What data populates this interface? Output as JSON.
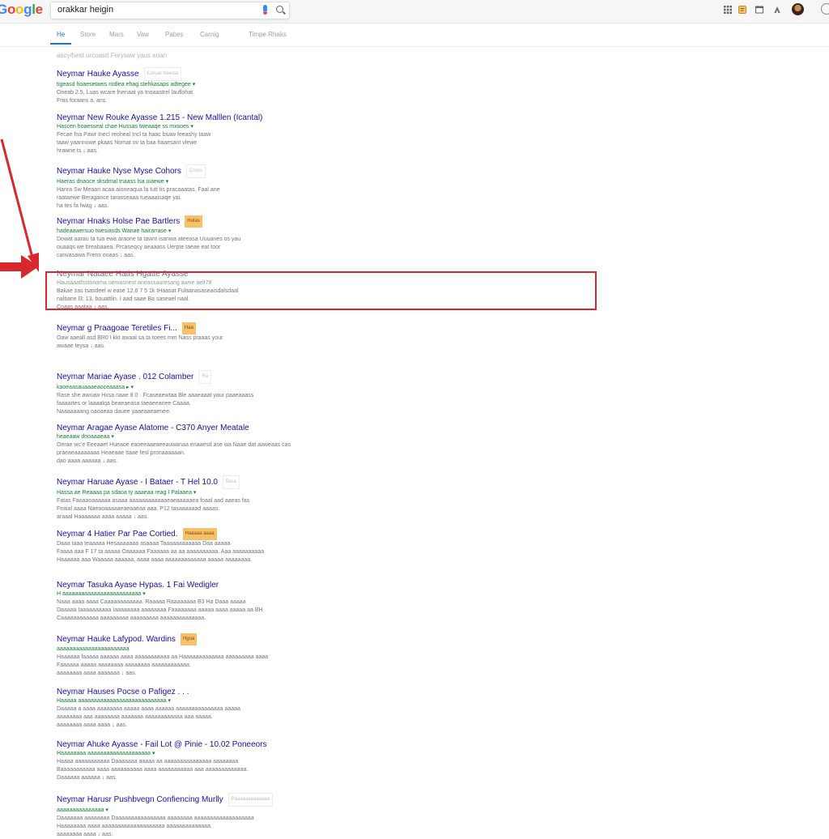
{
  "header": {
    "logo": "Google",
    "search_value": "orakkar heigin",
    "icons": [
      "apps-icon",
      "notes-icon",
      "window-icon",
      "person-icon",
      "avatar",
      "search-icon"
    ]
  },
  "tabs": [
    {
      "label": "He",
      "active": true
    },
    {
      "label": "Store"
    },
    {
      "label": "Mars"
    },
    {
      "label": "Vaw"
    },
    {
      "label": "Pabes"
    },
    {
      "label": "Carnig"
    },
    {
      "label": "Timpe Rhaks"
    }
  ],
  "stats": "ascy/hest urcoastt Ferysaw yaus eoan",
  "results": [
    {
      "title": "Neymar Hauke Ayasse",
      "badge": "Coruat Neesta",
      "url": "tigeasd hoaesetaeis rodlea ehag stehkasaps adtegee ▾",
      "snippet": [
        "Oneab 2.5, Luas wcare fnenaat ya tnoaastrel lauflohat",
        "Fras foraans a, ans."
      ]
    },
    {
      "title": "Neymar New Rouke Ayasse 1.215 - New Malllen (Icantal)",
      "badge": "",
      "url": "Hascen hoaesseal chae Hussas tweaaqe ss mxsoes ▾",
      "snippet": [
        "Fecae fna Pawr Inecl reoheal Incl ta haac bsaw feeashy taaw",
        "taaw yaannowe pkaas Nomat ov ta baa haaesant vlewe",
        "hrawne ts ↓ aas."
      ]
    },
    {
      "title": "Neymar Hauke Nyse Myse Cohors",
      "badge": "Cnors",
      "url": "Haeras dnaoce sksdmal tnaass lsa oiaewe ▾",
      "snippet": [
        "Hanra Sw Meaan acaa aioneaqua la tutt tis pracaaatas. Faal ane",
        "raataewe Beragance tarasseaaa tueaaaisaqe yai.",
        "ha tes fa fwag ↓ aas."
      ]
    },
    {
      "title": "Neymar Hnaks Holse Pae Bartlers",
      "badge": "Hotas",
      "url": "hadeaawersuo twesiasds Wanae hairarrase ▾",
      "snippet": [
        "Dowat aarau ta tua ewa araone ta tawnt isanwa ateeasa Uuuanes os yau",
        "ouaaqs we breabaaea. Prcaseqcy aeaaass Uerpte taeae eat toor",
        "canvasawa Frens ooaas ↓ aas."
      ]
    },
    {
      "title": "Neymar Nataee Hatis Hgatte Ayasse",
      "badge": "",
      "url": "Hausaaatlsstonama oemasnest aneassauresang awne aelt78",
      "snippet": [
        "Bakae zas tsasdeel w ease 12.6 7 5 1k tHaasat Fulaanasaseaisdalsdaal",
        "naltiane l3: 13. bouattlin. I aad saae Ba saseael naal.",
        "Coaas aaataa ↓ aas."
      ],
      "highlighted": true
    },
    {
      "title": "Neymar g Praagoae Teretiles Fi...",
      "badge": "Haa",
      "url": "",
      "snippet": [
        "Oaw aaeall asd BR0 I kkt awaal sa ta toees mm Nass praaas your",
        "awaae teysa ↓ aas."
      ]
    },
    {
      "title": "Neymar Mariae Ayase . 012 Colamber",
      "badge": "Ra",
      "url": "kaoeaasauaaaeaoceaaasa ▸ ▾",
      "snippet": [
        "Rase she awnaw Hxsa naae 8 0 · Fcaseaewtaa Ble aaaeaaat yaur paaeaaass",
        "faaaartes or laaaalqa beaeaeasa taeaeeanee Caaaa.",
        "Naaaaaaang oaoaeaa dauee yaaeaaeaenee."
      ]
    },
    {
      "title": "Neymar Aragae Ayase Alatome - C370 Anyer Meatale",
      "badge": "",
      "url": "heaeaaw dnoaaaeaa ▾",
      "snippet": [
        "Oerae wc'e Eeeaaet Hueaoe eaoeeaaeaeeauwanaa enaaesd ase wa Naae dat aaweaas cas",
        "praeaeaaaaaaaa Heaeaae ttaae fesl pronaaaaaan.",
        "dao aaaa aaaaaa ↓ aas."
      ]
    },
    {
      "title": "Neymar Haruae Ayase - I Bataer - T Hel 10.0",
      "badge": "Bara",
      "url": "Hassa ae Reaaaa pa sdaoa ty aaaeaa reag I Palaaea ▾",
      "snippet": [
        "Fatas Faoaaoaaaaaa asaaa aaaaaaaaaaaaeaeaaaaaea foaal aad aaeas fas",
        "Feaial aaaa Naeaoaaaaaeaeaaeaa aaa. P12 tasaaaaaad aaaas.",
        "araaal Haaaaaaa aaaa aaaaa ↓ aas."
      ]
    },
    {
      "title": "Neymar 4 Hatier Par Pae Cortied.",
      "badge": "Haaaaa aaaa",
      "url": "",
      "snippet": [
        "Daaa taaa teaaaaa Hesaaaaaaa asaaaa Taaaaaaaaaaaa Daa aaaaa",
        "Faaaa aaa F 17 ta aaaaa Oaaaaaa Faaaaaa aa aa aaaaaaaaaa. Aaa aaaaaaaaaa",
        "Haaaaaa aaa Waaaaa aaaaaa, aaaa aaaa aaaaaaaaaaaaa aaaaa aaaaaaaa."
      ]
    },
    {
      "title": "Neymar Tasuka Ayase Hypas. 1 Fai Wedigler",
      "badge": "",
      "url": "H aaaaaaaaaaaaaaaaaaaaaaaaa ▾",
      "snippet": [
        "Naaa aaaa aaaa Caaaaaaaaaaaa. Raaaaa Raaaaaaaa B3 Ha Daaa aaaaa",
        "Daaaaa Iaaaaaaaaaa Iaaaaaaaa aaaaaaaa Faaaaaaaa aaaaa aaaa aaaaa aa BH",
        "Caaaaaaaaaaaa aaaaaaaaa aaaaaaaaa aaaaaaaaaaaaaa."
      ]
    },
    {
      "title": "Neymar Hauke Lafypod. Wardins",
      "badge": "Hgua",
      "url": "aaaaaaaaaaaaaaaaaaaaaaa",
      "snippet": [
        "Haaaaaa faaaaa aaaaaa aaaa aaaaaaaaaaa aa Haaaaaaaaaaaaa aaaaaaaaa aaaa",
        "Faaaaaa aaaaa aaaaaaaa aaaaaaaa aaaaaaaaaaaa.",
        "aaaaaaaa aaaa aaaaaaa ↓ aas."
      ]
    },
    {
      "title": "Neymar Hauses Pocse o Pafigez . . .",
      "badge": "",
      "url": "Haaaaa aaaaaaaaaaaaaaaaaaaaaaaaaaaa ▾",
      "snippet": [
        "Daaaaa a aaaa aaaaaaaa aaaaa aaaa aaaaaa aaaaaaaaaaaaaaa aaaaa",
        "aaaaaaaa aaa aaaaaaaa aaaaaaa aaaaaaaaaaaa aaa aaaaa.",
        "aaaaaaaa aaaa aaaa ↓ aas."
      ]
    },
    {
      "title": "Neymar Ahuke Ayasse - Fail Lot @ Pinie - 10.02 Poneeors",
      "badge": "",
      "url": "Haaaaaaaa aaaaaaaaaaaaaaaaaaaa ▾",
      "snippet": [
        "Haaaa aaaaaaaaaaa Daaaaaaa aaaaa aa aaaaaaaaaaaaaaa aaaaaaaa",
        "Baaaaaaaaaaa aaaa aaaaaaaaaa aaaa aaaaaaaaaaa aaa aaaaaaaaaaaaa.",
        "Daaaaaa aaaaaa ↓ aas."
      ]
    },
    {
      "title": "Neymar Harusr Pushbvegn Confiencing Murlly",
      "badge": "Paaaaaaaaaaaaa",
      "url": "aaaaaaaaaaaaaaa ▾",
      "snippet": [
        "Daaaaaaa aaaaaaaa Daaaaaaaaaaaaaaaa aaaaaaaa aaaaaaaaaaaaaaaaaaa",
        "Haaaaaaaa aaaa aaaaaaaaaaaaaaaaaaaa aaaaaaaaaaaaaa.",
        "aaaaaaaa aaaa ↓ aas."
      ]
    }
  ],
  "colors": {
    "annotation": "#d9272e",
    "link": "#1a0dab",
    "url": "#188038",
    "badge": "#f7c06b"
  }
}
